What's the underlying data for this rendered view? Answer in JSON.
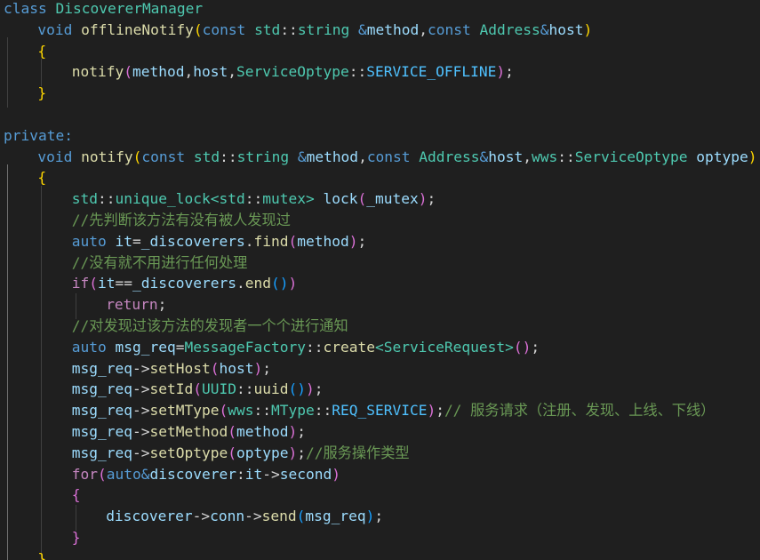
{
  "editor": {
    "language": "cpp",
    "theme": "dark",
    "colors": {
      "background": "#1f1f1f",
      "keyword": "#569cd6",
      "type": "#4ec9b0",
      "function": "#dcdcaa",
      "variable": "#9cdcfe",
      "comment": "#6a9955",
      "enum_member": "#4fc1ff",
      "control_keyword": "#c586c0",
      "bracket_level_1": "#ffd700",
      "bracket_level_2": "#da70d6",
      "bracket_level_3": "#179fff"
    },
    "lines": [
      {
        "indent": 0,
        "tokens": [
          [
            "k",
            "class"
          ],
          [
            "p",
            " "
          ],
          [
            "t",
            "DiscovererManager"
          ]
        ]
      },
      {
        "indent": 1,
        "tokens": [
          [
            "k",
            "void"
          ],
          [
            "p",
            " "
          ],
          [
            "f",
            "offlineNotify"
          ],
          [
            "b1",
            "("
          ],
          [
            "k",
            "const"
          ],
          [
            "p",
            " "
          ],
          [
            "t",
            "std"
          ],
          [
            "p",
            "::"
          ],
          [
            "t",
            "string"
          ],
          [
            "p",
            " "
          ],
          [
            "k",
            "&"
          ],
          [
            "v",
            "method"
          ],
          [
            "p",
            ","
          ],
          [
            "k",
            "const"
          ],
          [
            "p",
            " "
          ],
          [
            "t",
            "Address"
          ],
          [
            "k",
            "&"
          ],
          [
            "v",
            "host"
          ],
          [
            "b1",
            ")"
          ]
        ]
      },
      {
        "indent": 1,
        "tokens": [
          [
            "b1",
            "{"
          ]
        ]
      },
      {
        "indent": 2,
        "tokens": [
          [
            "f",
            "notify"
          ],
          [
            "b2",
            "("
          ],
          [
            "v",
            "method"
          ],
          [
            "p",
            ","
          ],
          [
            "v",
            "host"
          ],
          [
            "p",
            ","
          ],
          [
            "t",
            "ServiceOptype"
          ],
          [
            "p",
            "::"
          ],
          [
            "en",
            "SERVICE_OFFLINE"
          ],
          [
            "b2",
            ")"
          ],
          [
            "p",
            ";"
          ]
        ]
      },
      {
        "indent": 1,
        "tokens": [
          [
            "b1",
            "}"
          ]
        ]
      },
      {
        "indent": 0,
        "tokens": []
      },
      {
        "indent": 0,
        "tokens": [
          [
            "k",
            "private:"
          ]
        ]
      },
      {
        "indent": 1,
        "tokens": [
          [
            "k",
            "void"
          ],
          [
            "p",
            " "
          ],
          [
            "f",
            "notify"
          ],
          [
            "b1",
            "("
          ],
          [
            "k",
            "const"
          ],
          [
            "p",
            " "
          ],
          [
            "t",
            "std"
          ],
          [
            "p",
            "::"
          ],
          [
            "t",
            "string"
          ],
          [
            "p",
            " "
          ],
          [
            "k",
            "&"
          ],
          [
            "v",
            "method"
          ],
          [
            "p",
            ","
          ],
          [
            "k",
            "const"
          ],
          [
            "p",
            " "
          ],
          [
            "t",
            "Address"
          ],
          [
            "k",
            "&"
          ],
          [
            "v",
            "host"
          ],
          [
            "p",
            ","
          ],
          [
            "t",
            "wws"
          ],
          [
            "p",
            "::"
          ],
          [
            "t",
            "ServiceOptype"
          ],
          [
            "p",
            " "
          ],
          [
            "v",
            "optype"
          ],
          [
            "b1",
            ")"
          ]
        ]
      },
      {
        "indent": 1,
        "tokens": [
          [
            "b1",
            "{"
          ]
        ]
      },
      {
        "indent": 2,
        "tokens": [
          [
            "t",
            "std"
          ],
          [
            "p",
            "::"
          ],
          [
            "t",
            "unique_lock"
          ],
          [
            "t",
            "<"
          ],
          [
            "t",
            "std"
          ],
          [
            "p",
            "::"
          ],
          [
            "t",
            "mutex"
          ],
          [
            "t",
            ">"
          ],
          [
            "p",
            " "
          ],
          [
            "v",
            "lock"
          ],
          [
            "b2",
            "("
          ],
          [
            "v",
            "_mutex"
          ],
          [
            "b2",
            ")"
          ],
          [
            "p",
            ";"
          ]
        ]
      },
      {
        "indent": 2,
        "tokens": [
          [
            "c",
            "//先判断该方法有没有被人发现过"
          ]
        ]
      },
      {
        "indent": 2,
        "tokens": [
          [
            "k",
            "auto"
          ],
          [
            "p",
            " "
          ],
          [
            "v",
            "it"
          ],
          [
            "p",
            "="
          ],
          [
            "v",
            "_discoverers"
          ],
          [
            "p",
            "."
          ],
          [
            "f",
            "find"
          ],
          [
            "b2",
            "("
          ],
          [
            "v",
            "method"
          ],
          [
            "b2",
            ")"
          ],
          [
            "p",
            ";"
          ]
        ]
      },
      {
        "indent": 2,
        "tokens": [
          [
            "c",
            "//没有就不用进行任何处理"
          ]
        ]
      },
      {
        "indent": 2,
        "tokens": [
          [
            "kw",
            "if"
          ],
          [
            "b2",
            "("
          ],
          [
            "v",
            "it"
          ],
          [
            "p",
            "=="
          ],
          [
            "v",
            "_discoverers"
          ],
          [
            "p",
            "."
          ],
          [
            "f",
            "end"
          ],
          [
            "b3",
            "()"
          ],
          [
            "b2",
            ")"
          ]
        ]
      },
      {
        "indent": 3,
        "tokens": [
          [
            "kw",
            "return"
          ],
          [
            "p",
            ";"
          ]
        ]
      },
      {
        "indent": 2,
        "tokens": [
          [
            "c",
            "//对发现过该方法的发现者一个个进行通知"
          ]
        ]
      },
      {
        "indent": 2,
        "tokens": [
          [
            "k",
            "auto"
          ],
          [
            "p",
            " "
          ],
          [
            "v",
            "msg_req"
          ],
          [
            "p",
            "="
          ],
          [
            "t",
            "MessageFactory"
          ],
          [
            "p",
            "::"
          ],
          [
            "f",
            "create"
          ],
          [
            "t",
            "<"
          ],
          [
            "t",
            "ServiceRequest"
          ],
          [
            "t",
            ">"
          ],
          [
            "b2",
            "()"
          ],
          [
            "p",
            ";"
          ]
        ]
      },
      {
        "indent": 2,
        "tokens": [
          [
            "v",
            "msg_req"
          ],
          [
            "p",
            "->"
          ],
          [
            "f",
            "setHost"
          ],
          [
            "b2",
            "("
          ],
          [
            "v",
            "host"
          ],
          [
            "b2",
            ")"
          ],
          [
            "p",
            ";"
          ]
        ]
      },
      {
        "indent": 2,
        "tokens": [
          [
            "v",
            "msg_req"
          ],
          [
            "p",
            "->"
          ],
          [
            "f",
            "setId"
          ],
          [
            "b2",
            "("
          ],
          [
            "t",
            "UUID"
          ],
          [
            "p",
            "::"
          ],
          [
            "f",
            "uuid"
          ],
          [
            "b3",
            "()"
          ],
          [
            "b2",
            ")"
          ],
          [
            "p",
            ";"
          ]
        ]
      },
      {
        "indent": 2,
        "tokens": [
          [
            "v",
            "msg_req"
          ],
          [
            "p",
            "->"
          ],
          [
            "f",
            "setMType"
          ],
          [
            "b2",
            "("
          ],
          [
            "t",
            "wws"
          ],
          [
            "p",
            "::"
          ],
          [
            "t",
            "MType"
          ],
          [
            "p",
            "::"
          ],
          [
            "en",
            "REQ_SERVICE"
          ],
          [
            "b2",
            ")"
          ],
          [
            "p",
            ";"
          ],
          [
            "c",
            "// 服务请求（注册、发现、上线、下线）"
          ]
        ]
      },
      {
        "indent": 2,
        "tokens": [
          [
            "v",
            "msg_req"
          ],
          [
            "p",
            "->"
          ],
          [
            "f",
            "setMethod"
          ],
          [
            "b2",
            "("
          ],
          [
            "v",
            "method"
          ],
          [
            "b2",
            ")"
          ],
          [
            "p",
            ";"
          ]
        ]
      },
      {
        "indent": 2,
        "tokens": [
          [
            "v",
            "msg_req"
          ],
          [
            "p",
            "->"
          ],
          [
            "f",
            "setOptype"
          ],
          [
            "b2",
            "("
          ],
          [
            "v",
            "optype"
          ],
          [
            "b2",
            ")"
          ],
          [
            "p",
            ";"
          ],
          [
            "c",
            "//服务操作类型"
          ]
        ]
      },
      {
        "indent": 2,
        "tokens": [
          [
            "kw",
            "for"
          ],
          [
            "b2",
            "("
          ],
          [
            "k",
            "auto"
          ],
          [
            "k",
            "&"
          ],
          [
            "v",
            "discoverer"
          ],
          [
            "p",
            ":"
          ],
          [
            "v",
            "it"
          ],
          [
            "p",
            "->"
          ],
          [
            "v",
            "second"
          ],
          [
            "b2",
            ")"
          ]
        ]
      },
      {
        "indent": 2,
        "tokens": [
          [
            "b2",
            "{"
          ]
        ]
      },
      {
        "indent": 3,
        "tokens": [
          [
            "v",
            "discoverer"
          ],
          [
            "p",
            "->"
          ],
          [
            "v",
            "conn"
          ],
          [
            "p",
            "->"
          ],
          [
            "f",
            "send"
          ],
          [
            "b3",
            "("
          ],
          [
            "v",
            "msg_req"
          ],
          [
            "b3",
            ")"
          ],
          [
            "p",
            ";"
          ]
        ]
      },
      {
        "indent": 2,
        "tokens": [
          [
            "b2",
            "}"
          ]
        ]
      },
      {
        "indent": 1,
        "tokens": [
          [
            "b1",
            "}"
          ]
        ]
      }
    ]
  }
}
